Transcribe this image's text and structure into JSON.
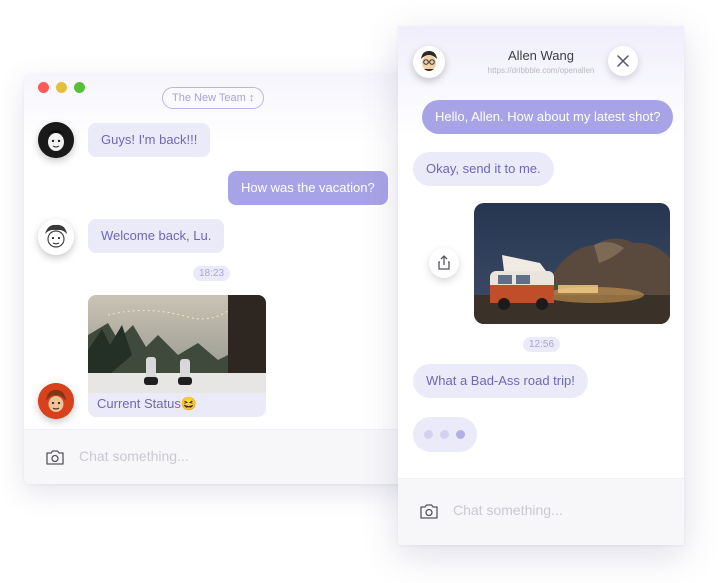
{
  "left_window": {
    "team_selector": "The New Team ↕",
    "messages": [
      {
        "text": "Guys! I'm back!!!"
      },
      {
        "text": "How was the vacation?"
      },
      {
        "text": "Welcome back, Lu."
      }
    ],
    "timestamp": "18:23",
    "image_caption": "Current Status😆",
    "input_placeholder": "Chat something..."
  },
  "right_window": {
    "contact_name": "Allen Wang",
    "contact_url": "https://dribbble.com/openallen",
    "messages": [
      {
        "text": "Hello, Allen. How about my latest shot?"
      },
      {
        "text": "Okay, send it to me."
      },
      {
        "text": "What a Bad-Ass road trip!"
      }
    ],
    "timestamp": "12:56",
    "input_placeholder": "Chat something..."
  },
  "colors": {
    "accent": "#a8a3e6",
    "incoming_bubble": "#ebeaf8",
    "incoming_text": "#6d67bb"
  },
  "icons": [
    "camera-icon",
    "close-icon",
    "share-icon"
  ]
}
